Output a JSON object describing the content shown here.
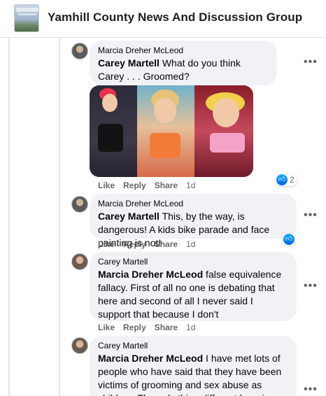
{
  "header": {
    "group_name": "Yamhill County News And Discussion Group"
  },
  "icons": {
    "more": "three-dots-icon",
    "like": "like-thumb-icon"
  },
  "colors": {
    "bubble": "#f0f2f5",
    "action_text": "#65676b",
    "like_blue": "#0866ff"
  },
  "comments": [
    {
      "author": "Marcia Dreher McLeod",
      "mention": "Carey Martell",
      "text": " What do you think Carey . . . Groomed?",
      "actions": {
        "like": "Like",
        "reply": "Reply",
        "share": "Share",
        "time": "1d"
      },
      "reaction_count": "2"
    },
    {
      "author": "Marcia Dreher McLeod",
      "mention": "Carey Martell",
      "text": " This, by the way, is dangerous! A kids bike parade and face painting is not!",
      "actions": {
        "like": "Like",
        "reply": "Reply",
        "share": "Share",
        "time": "1d"
      }
    },
    {
      "author": "Carey Martell",
      "mention": "Marcia Dreher McLeod",
      "text": " false equivalence fallacy. First of all no one is debating that here and second of all I never said I support that because I don't",
      "actions": {
        "like": "Like",
        "reply": "Reply",
        "share": "Share",
        "time": "1d"
      }
    },
    {
      "author": "Carey Martell",
      "mention": "Marcia Dreher McLeod",
      "text": " I have met lots of people who have said that they have been victims of grooming and sex abuse as children. The only thing different here is"
    }
  ]
}
